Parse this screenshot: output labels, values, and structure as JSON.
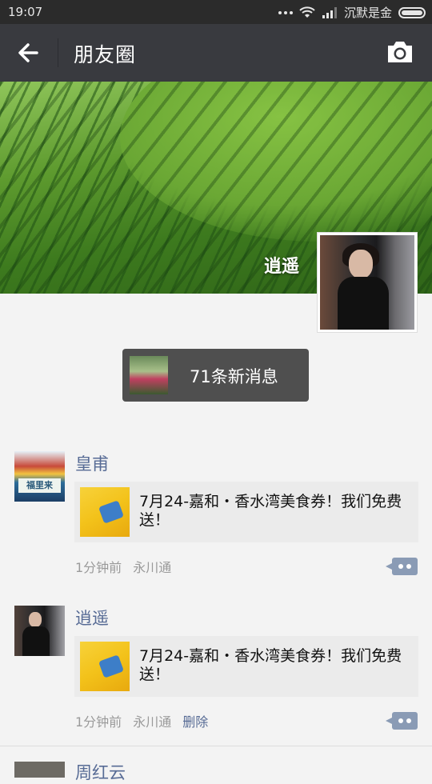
{
  "status_bar": {
    "time": "19:07",
    "carrier": "沉默是金"
  },
  "header": {
    "title": "朋友圈"
  },
  "profile": {
    "name": "逍遥"
  },
  "new_messages": {
    "label": "71条新消息"
  },
  "posts": [
    {
      "author": "皇甫",
      "avatar_sign": "福里来",
      "share_text": "7月24-嘉和・香水湾美食券！我们免费送！",
      "time": "1分钟前",
      "source": "永川通",
      "delete_label": ""
    },
    {
      "author": "逍遥",
      "share_text": "7月24-嘉和・香水湾美食券！我们免费送！",
      "time": "1分钟前",
      "source": "永川通",
      "delete_label": "删除"
    },
    {
      "author": "周红云"
    }
  ],
  "colors": {
    "nav_bg": "#393a3f",
    "link": "#576b95",
    "status_bg": "#2b2b2b"
  }
}
